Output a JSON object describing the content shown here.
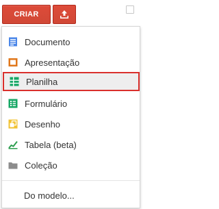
{
  "toolbar": {
    "create_label": "CRIAR",
    "upload_icon": "upload-icon"
  },
  "menu": {
    "items": [
      {
        "label": "Documento",
        "icon": "document-icon",
        "color": "#4a86e8"
      },
      {
        "label": "Apresentação",
        "icon": "presentation-icon",
        "color": "#e0771b"
      },
      {
        "label": "Planilha",
        "icon": "spreadsheet-icon",
        "color": "#16a765",
        "highlighted": true
      },
      {
        "label": "Formulário",
        "icon": "form-icon",
        "color": "#16a765"
      },
      {
        "label": "Desenho",
        "icon": "drawing-icon",
        "color": "#f1c232"
      },
      {
        "label": "Tabela (beta)",
        "icon": "table-icon",
        "color": "#2d9e4f"
      },
      {
        "label": "Coleção",
        "icon": "folder-icon",
        "color": "#8c8c8c"
      }
    ],
    "template_label": "Do modelo..."
  },
  "colors": {
    "accent": "#d14836",
    "highlight_border": "#d9302c"
  }
}
